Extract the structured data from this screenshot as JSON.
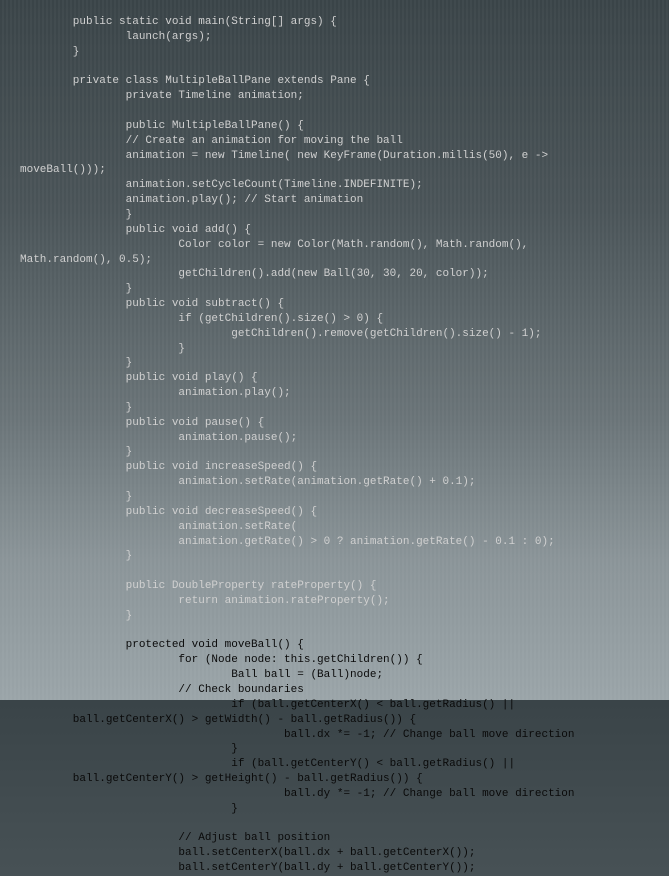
{
  "code": {
    "lines": [
      "        public static void main(String[] args) {",
      "                launch(args);",
      "        }",
      "",
      "        private class MultipleBallPane extends Pane {",
      "                private Timeline animation;",
      "",
      "                public MultipleBallPane() {",
      "                // Create an animation for moving the ball",
      "                animation = new Timeline( new KeyFrame(Duration.millis(50), e ->",
      "moveBall()));",
      "                animation.setCycleCount(Timeline.INDEFINITE);",
      "                animation.play(); // Start animation",
      "                }",
      "                public void add() {",
      "                        Color color = new Color(Math.random(), Math.random(),",
      "Math.random(), 0.5);",
      "                        getChildren().add(new Ball(30, 30, 20, color));",
      "                }",
      "                public void subtract() {",
      "                        if (getChildren().size() > 0) {",
      "                                getChildren().remove(getChildren().size() - 1);",
      "                        }",
      "                }",
      "                public void play() {",
      "                        animation.play();",
      "                }",
      "                public void pause() {",
      "                        animation.pause();",
      "                }",
      "                public void increaseSpeed() {",
      "                        animation.setRate(animation.getRate() + 0.1);",
      "                }",
      "                public void decreaseSpeed() {",
      "                        animation.setRate(",
      "                        animation.getRate() > 0 ? animation.getRate() - 0.1 : 0);",
      "                }",
      "",
      "                public DoubleProperty rateProperty() {",
      "                        return animation.rateProperty();",
      "                }",
      "",
      "                protected void moveBall() {",
      "                        for (Node node: this.getChildren()) {",
      "                                Ball ball = (Ball)node;",
      "                        // Check boundaries",
      "                                if (ball.getCenterX() < ball.getRadius() ||",
      "        ball.getCenterX() > getWidth() - ball.getRadius()) {",
      "                                        ball.dx *= -1; // Change ball move direction",
      "                                }",
      "                                if (ball.getCenterY() < ball.getRadius() ||",
      "        ball.getCenterY() > getHeight() - ball.getRadius()) {",
      "                                        ball.dy *= -1; // Change ball move direction",
      "                                }",
      "",
      "                        // Adjust ball position",
      "                        ball.setCenterX(ball.dx + ball.getCenterX());",
      "                        ball.setCenterY(ball.dy + ball.getCenterY());"
    ]
  }
}
